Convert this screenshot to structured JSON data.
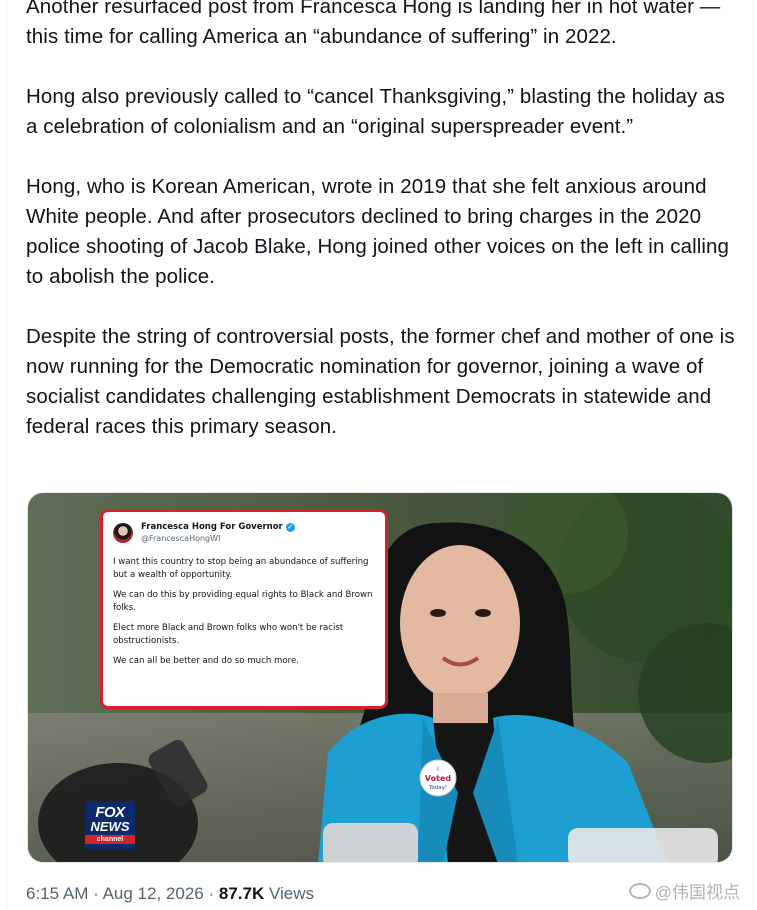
{
  "post": {
    "paragraphs": [
      "Another resurfaced post from Francesca Hong is landing her in hot water — this time for calling America an “abundance of suffering” in 2022.",
      "Hong also previously called to “cancel Thanksgiving,” blasting the holiday as a celebration of colonialism and an “original superspreader event.”",
      "Hong, who is Korean American, wrote in 2019 that she felt anxious around White people. And after prosecutors declined to bring charges in the 2020 police shooting of Jacob Blake, Hong joined other voices on the left in calling to abolish the police.",
      "Despite the string of controversial posts, the former chef and mother of one is now running for the Democratic nomination for governor, joining a wave of socialist candidates challenging establishment Democrats in statewide and federal races this primary season."
    ]
  },
  "media": {
    "quoted_post": {
      "name": "Francesca Hong For Governor",
      "handle": "@FrancescaHongWI",
      "lines": [
        "I want this country to stop being an abundance of suffering but a wealth of opportunity.",
        "We can do this by providing equal rights to Black and Brown folks.",
        "Elect more Black and Brown folks who won't be racist obstructionists.",
        "We can all be better and do so much more."
      ]
    },
    "sticker": {
      "line1": "I",
      "line2": "Voted",
      "line3": "Today!"
    },
    "logo": {
      "line1": "FOX",
      "line2": "NEWS",
      "line3": "channel"
    },
    "colors": {
      "quote_border": "#d2232a",
      "jacket": "#1e9fd2",
      "fox_blue": "#0a2a6b"
    }
  },
  "meta": {
    "time": "6:15 AM",
    "date": "Aug 12, 2026",
    "views_count": "87.7K",
    "views_label": "Views",
    "separator": "·"
  },
  "watermark": {
    "text": "@伟国视点",
    "icon": "weibo-icon"
  }
}
